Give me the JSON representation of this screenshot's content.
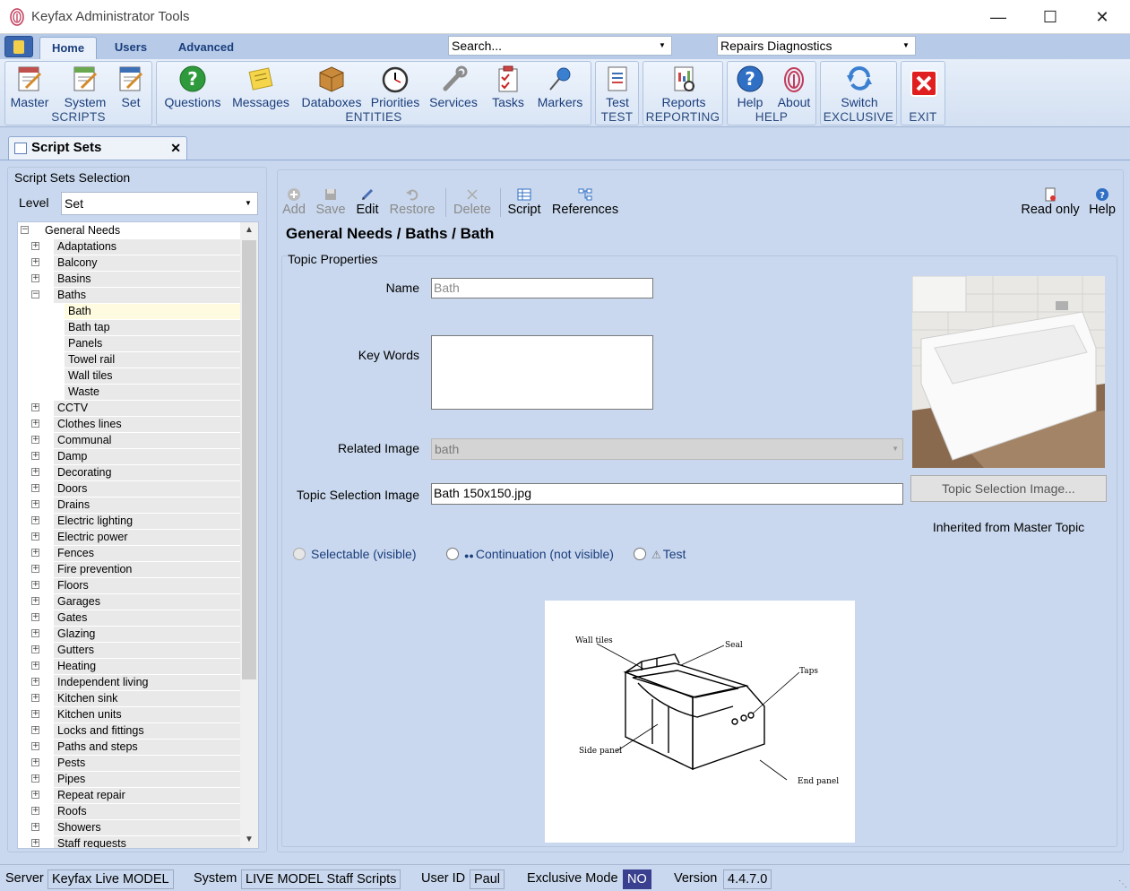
{
  "window": {
    "title": "Keyfax Administrator Tools"
  },
  "ribbon": {
    "tabs": [
      "Home",
      "Users",
      "Advanced"
    ],
    "search_placeholder": "Search...",
    "context_select": "Repairs Diagnostics",
    "groups": {
      "scripts": {
        "label": "SCRIPTS",
        "buttons": [
          "Master",
          "System",
          "Set"
        ]
      },
      "entities": {
        "label": "ENTITIES",
        "buttons": [
          "Questions",
          "Messages",
          "Databoxes",
          "Priorities",
          "Services",
          "Tasks",
          "Markers"
        ]
      },
      "test": {
        "label": "TEST",
        "buttons": [
          "Test"
        ]
      },
      "reporting": {
        "label": "REPORTING",
        "buttons": [
          "Reports"
        ]
      },
      "help": {
        "label": "HELP",
        "buttons": [
          "Help",
          "About"
        ]
      },
      "exclusive": {
        "label": "EXCLUSIVE",
        "buttons": [
          "Switch"
        ]
      },
      "exit": {
        "label": "EXIT"
      }
    }
  },
  "doc_tab": {
    "label": "Script Sets"
  },
  "left_panel": {
    "title": "Script Sets Selection",
    "level_label": "Level",
    "level_value": "Set",
    "tree_root": "General Needs",
    "tree_items": [
      {
        "label": "Adaptations",
        "state": "+"
      },
      {
        "label": "Balcony",
        "state": "+"
      },
      {
        "label": "Basins",
        "state": "+"
      },
      {
        "label": "Baths",
        "state": "-"
      },
      {
        "label": "Bath",
        "child": true,
        "selected": true
      },
      {
        "label": "Bath tap",
        "child": true
      },
      {
        "label": "Panels",
        "child": true
      },
      {
        "label": "Towel rail",
        "child": true
      },
      {
        "label": "Wall tiles",
        "child": true
      },
      {
        "label": "Waste",
        "child": true
      },
      {
        "label": "CCTV",
        "state": "+"
      },
      {
        "label": "Clothes lines",
        "state": "+"
      },
      {
        "label": "Communal",
        "state": "+"
      },
      {
        "label": "Damp",
        "state": "+"
      },
      {
        "label": "Decorating",
        "state": "+"
      },
      {
        "label": "Doors",
        "state": "+"
      },
      {
        "label": "Drains",
        "state": "+"
      },
      {
        "label": "Electric lighting",
        "state": "+"
      },
      {
        "label": "Electric power",
        "state": "+"
      },
      {
        "label": "Fences",
        "state": "+"
      },
      {
        "label": "Fire prevention",
        "state": "+"
      },
      {
        "label": "Floors",
        "state": "+"
      },
      {
        "label": "Garages",
        "state": "+"
      },
      {
        "label": "Gates",
        "state": "+"
      },
      {
        "label": "Glazing",
        "state": "+"
      },
      {
        "label": "Gutters",
        "state": "+"
      },
      {
        "label": "Heating",
        "state": "+"
      },
      {
        "label": "Independent living",
        "state": "+"
      },
      {
        "label": "Kitchen sink",
        "state": "+"
      },
      {
        "label": "Kitchen units",
        "state": "+"
      },
      {
        "label": "Locks and fittings",
        "state": "+"
      },
      {
        "label": "Paths and steps",
        "state": "+"
      },
      {
        "label": "Pests",
        "state": "+"
      },
      {
        "label": "Pipes",
        "state": "+"
      },
      {
        "label": "Repeat repair",
        "state": "+"
      },
      {
        "label": "Roofs",
        "state": "+"
      },
      {
        "label": "Showers",
        "state": "+"
      },
      {
        "label": "Staff requests",
        "state": "+"
      }
    ]
  },
  "toolbar": {
    "add": "Add",
    "save": "Save",
    "edit": "Edit",
    "restore": "Restore",
    "delete": "Delete",
    "script": "Script",
    "references": "References",
    "read_only": "Read only",
    "help": "Help"
  },
  "topic": {
    "breadcrumb": "General Needs / Baths / Bath",
    "section_title": "Topic Properties",
    "name_label": "Name",
    "name_placeholder": "Bath",
    "keywords_label": "Key Words",
    "related_image_label": "Related Image",
    "related_image_value": "bath",
    "selection_image_label": "Topic Selection Image",
    "selection_image_value": "Bath 150x150.jpg",
    "selection_image_button": "Topic Selection Image...",
    "inherited_note": "Inherited from Master Topic",
    "radio_selectable": "Selectable (visible)",
    "radio_continuation": "Continuation (not visible)",
    "radio_test": "Test",
    "diagram_labels": {
      "wall_tiles": "Wall tiles",
      "seal": "Seal",
      "taps": "Taps",
      "side_panel": "Side panel",
      "end_panel": "End panel"
    }
  },
  "status": {
    "server_label": "Server",
    "server_value": "Keyfax Live MODEL",
    "system_label": "System",
    "system_value": "LIVE MODEL Staff Scripts",
    "user_label": "User ID",
    "user_value": "Paul",
    "exclusive_label": "Exclusive Mode",
    "exclusive_value": "NO",
    "version_label": "Version",
    "version_value": "4.4.7.0"
  }
}
